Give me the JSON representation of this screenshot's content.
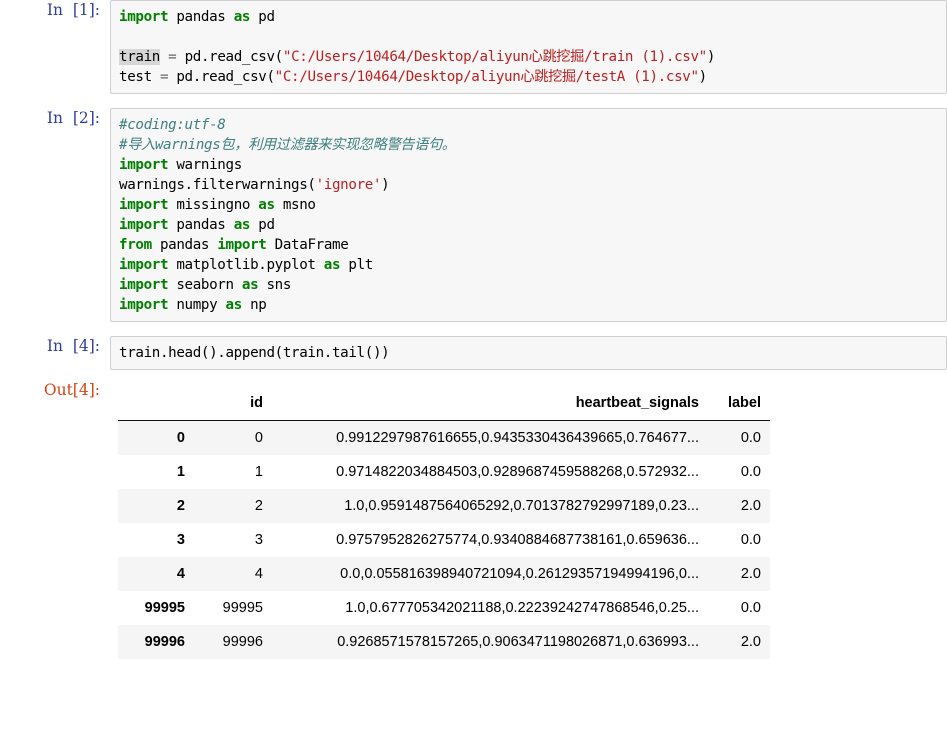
{
  "notebook": {
    "cells": [
      {
        "prompt_label": "In  [1]:",
        "type": "code",
        "lines": [
          "import pandas as pd",
          "",
          "train = pd.read_csv(\"C:/Users/10464/Desktop/aliyun心跳挖掘/train (1).csv\")",
          "test = pd.read_csv(\"C:/Users/10464/Desktop/aliyun心跳挖掘/testA (1).csv\")"
        ]
      },
      {
        "prompt_label": "In  [2]:",
        "type": "code",
        "lines": [
          "#coding:utf-8",
          "#导入warnings包，利用过滤器来实现忽略警告语句。",
          "import warnings",
          "warnings.filterwarnings('ignore')",
          "import missingno as msno",
          "import pandas as pd",
          "from pandas import DataFrame",
          "import matplotlib.pyplot as plt",
          "import seaborn as sns",
          "import numpy as np"
        ]
      },
      {
        "prompt_label": "In  [4]:",
        "type": "code",
        "lines": [
          "train.head().append(train.tail())"
        ]
      }
    ],
    "output": {
      "prompt_label": "Out[4]:",
      "table": {
        "columns": [
          "",
          "id",
          "heartbeat_signals",
          "label"
        ],
        "rows": [
          {
            "index": "0",
            "id": "0",
            "heartbeat_signals": "0.9912297987616655,0.9435330436439665,0.764677...",
            "label": "0.0"
          },
          {
            "index": "1",
            "id": "1",
            "heartbeat_signals": "0.9714822034884503,0.9289687459588268,0.572932...",
            "label": "0.0"
          },
          {
            "index": "2",
            "id": "2",
            "heartbeat_signals": "1.0,0.9591487564065292,0.7013782792997189,0.23...",
            "label": "2.0"
          },
          {
            "index": "3",
            "id": "3",
            "heartbeat_signals": "0.9757952826275774,0.9340884687738161,0.659636...",
            "label": "0.0"
          },
          {
            "index": "4",
            "id": "4",
            "heartbeat_signals": "0.0,0.055816398940721094,0.26129357194994196,0...",
            "label": "2.0"
          },
          {
            "index": "99995",
            "id": "99995",
            "heartbeat_signals": "1.0,0.677705342021188,0.22239242747868546,0.25...",
            "label": "0.0"
          },
          {
            "index": "99996",
            "id": "99996",
            "heartbeat_signals": "0.9268571578157265,0.9063471198026871,0.636993...",
            "label": "2.0"
          }
        ]
      }
    }
  },
  "colors": {
    "prompt_in": "#303F9F",
    "prompt_out": "#D84315",
    "keyword": "#008000",
    "string": "#BA2121",
    "comment": "#408080",
    "operator": "#666666",
    "cell_bg": "#f7f7f7",
    "cell_border": "#cfcfcf",
    "row_stripe": "#f5f5f5",
    "highlight": "#d6d6d6"
  }
}
